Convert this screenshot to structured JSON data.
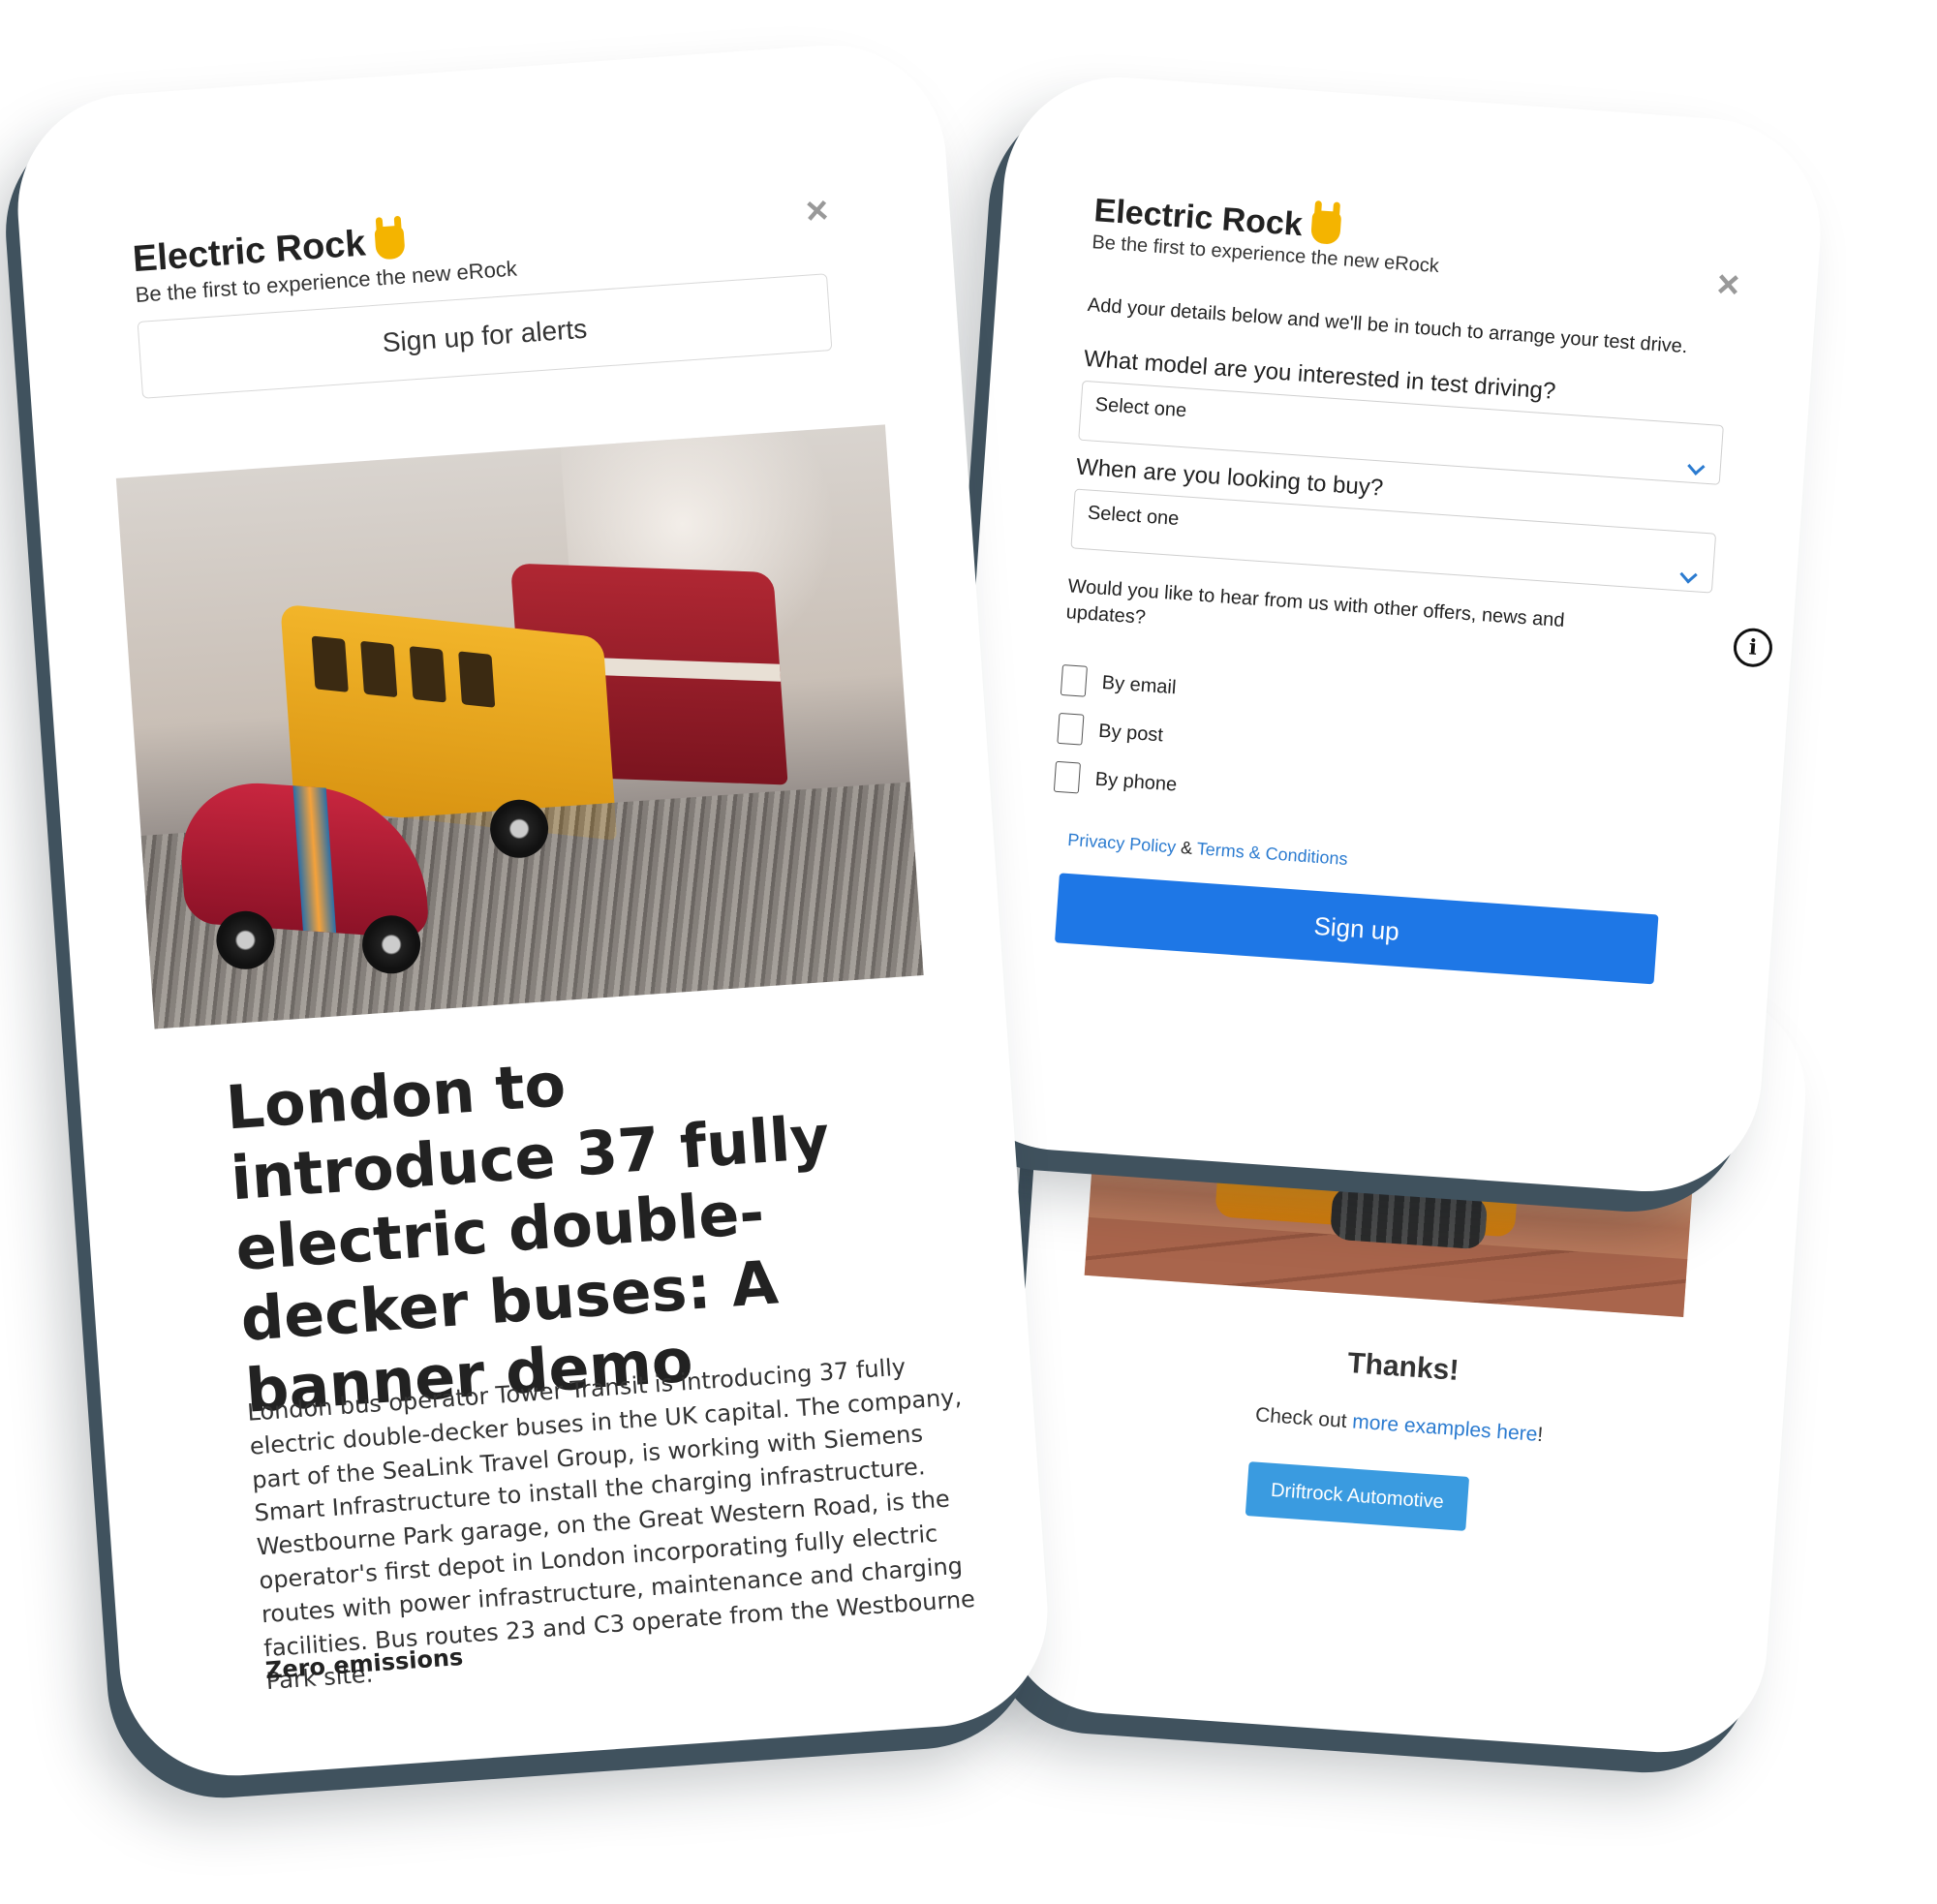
{
  "article_card": {
    "brand_name": "Electric Rock",
    "brand_icon": "rock-on-hand-icon",
    "tagline": "Be the first to experience the new eRock",
    "close_label": "×",
    "alert_button_label": "Sign up for alerts",
    "title": "London to introduce 37 fully electric double-decker buses: A banner demo",
    "body": "London bus operator Tower Transit is introducing 37 fully electric double-decker buses in the UK capital. The company, part of the SeaLink Travel Group, is working with Siemens Smart Infrastructure to install the charging infrastructure. Westbourne Park garage, on the Great Western Road, is the operator's first depot in London incorporating fully electric routes with power infrastructure, maintenance and charging facilities. Bus routes 23 and C3 operate from the Westbourne Park site.",
    "subheading": "Zero emissions"
  },
  "form_card": {
    "brand_name": "Electric Rock",
    "brand_icon": "rock-on-hand-icon",
    "tagline": "Be the first to experience the new eRock",
    "close_label": "×",
    "intro": "Add your details below and we'll be in touch to arrange your test drive.",
    "model_question": "What model are you interested in test driving?",
    "model_select_value": "Select one",
    "timing_question": "When are you looking to buy?",
    "timing_select_value": "Select one",
    "optin_question": "Would you like to hear from us with other offers, news and updates?",
    "info_icon_glyph": "i",
    "checkboxes": [
      {
        "label": "By email",
        "checked": false
      },
      {
        "label": "By post",
        "checked": false
      },
      {
        "label": "By phone",
        "checked": false
      }
    ],
    "privacy_link": "Privacy Policy",
    "links_separator": "&",
    "terms_link": "Terms & Conditions",
    "submit_label": "Sign up"
  },
  "thanks_card": {
    "title": "Thanks!",
    "text_prefix": "Check out",
    "link_text": "more examples here",
    "text_suffix": "!",
    "button_label": "Driftrock Automotive"
  },
  "colors": {
    "primary_button": "#1e77e6",
    "secondary_button": "#3a9be0",
    "link": "#2b7bd0",
    "backdrop_shadow": "#40525e"
  }
}
